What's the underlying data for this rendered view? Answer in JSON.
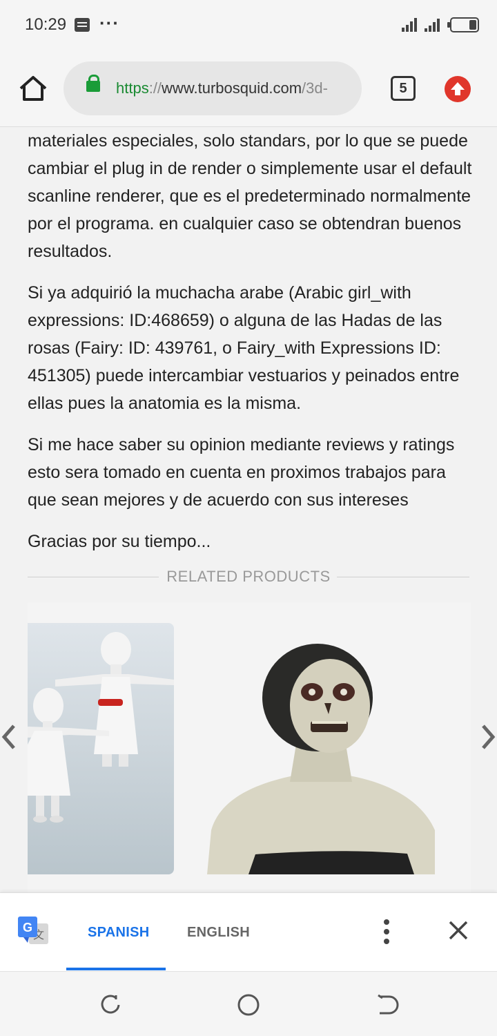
{
  "status_bar": {
    "time": "10:29",
    "dots": "···"
  },
  "browser": {
    "url_scheme": "https",
    "url_separator": "://",
    "url_host": "www.turbosquid.com",
    "url_path": "/3d-",
    "tab_count": "5",
    "colors": {
      "secure": "#1a9c38",
      "update": "#e0362b"
    }
  },
  "article": {
    "paragraphs": [
      "materiales especiales, solo standars, por lo que se puede cambiar el plug in de render o simplemente usar el default scanline renderer, que es el predeterminado normalmente por el programa. en cualquier caso se obtendran buenos resultados.",
      "Si ya adquirió la muchacha arabe (Arabic girl_with expressions: ID:468659) o alguna de las Hadas de las rosas (Fairy: ID: 439761, o Fairy_with Expressions ID: 451305) puede intercambiar vestuarios y peinados entre ellas pues la anatomia es la misma.",
      "Si me hace saber su opinion mediante reviews y ratings esto sera tomado en cuenta en proximos trabajos para que sean mejores y de acuerdo con sus intereses",
      "Gracias por su tiempo..."
    ]
  },
  "related": {
    "label": "RELATED PRODUCTS",
    "prev_icon": "chevron-left-icon",
    "next_icon": "chevron-right-icon"
  },
  "translate_bar": {
    "tabs": [
      "SPANISH",
      "ENGLISH"
    ],
    "selected": "SPANISH",
    "accent": "#1a73e8"
  },
  "nav_bar": {
    "buttons": [
      "recents-icon",
      "home-icon",
      "back-icon"
    ]
  }
}
